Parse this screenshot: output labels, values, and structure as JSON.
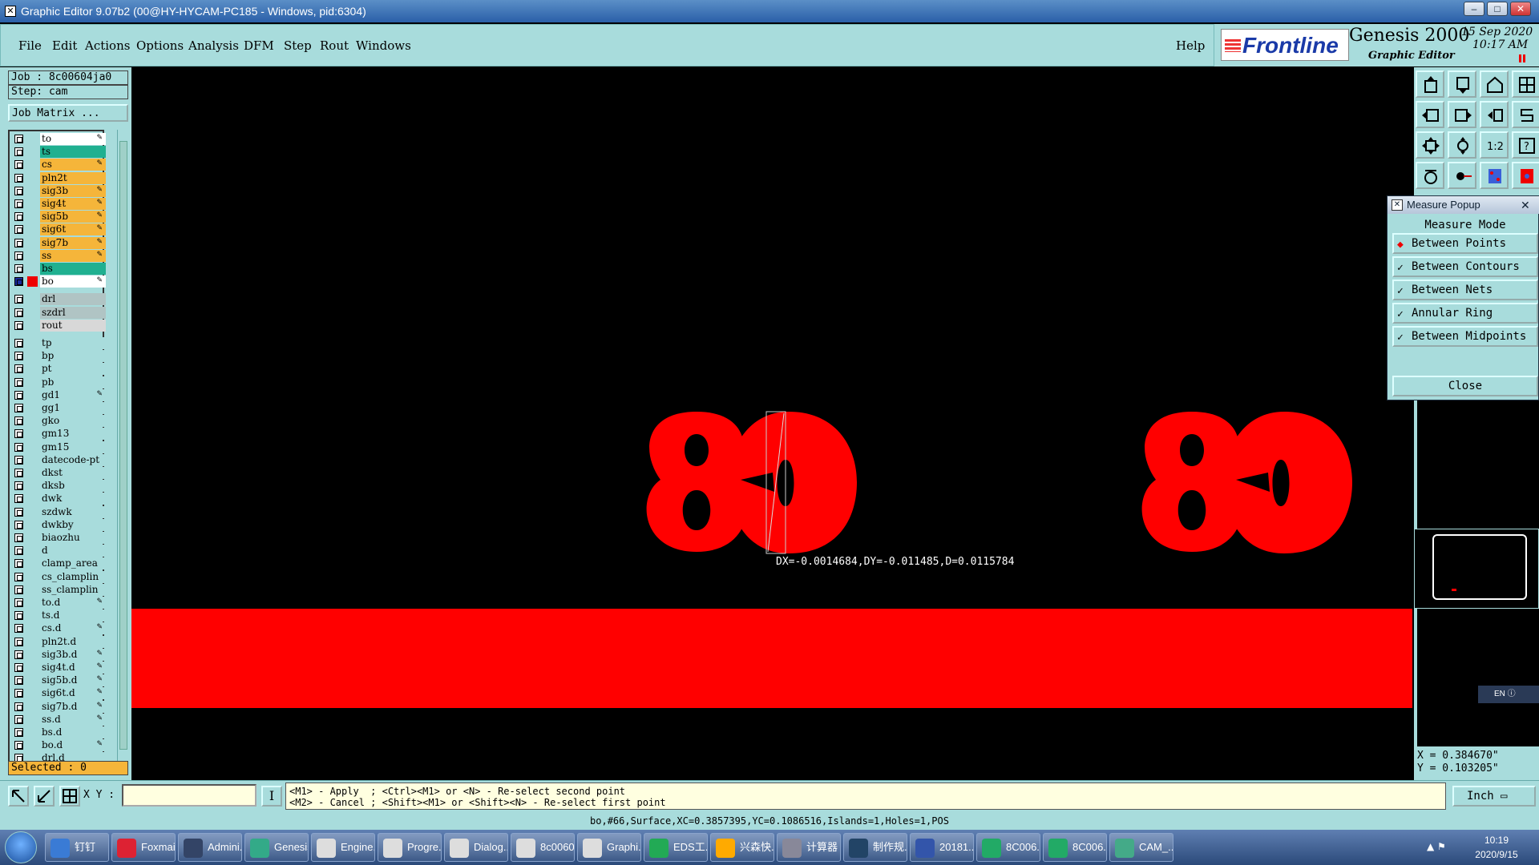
{
  "window": {
    "title": "Graphic Editor 9.07b2 (00@HY-HYCAM-PC185 - Windows, pid:6304)"
  },
  "menu": {
    "items": [
      "File",
      "Edit",
      "Actions",
      "Options",
      "Analysis",
      "DFM",
      "Step",
      "Rout",
      "Windows"
    ],
    "help": "Help"
  },
  "brand": {
    "logo": "Frontline",
    "product": "Genesis 2000",
    "subtitle": "Graphic Editor",
    "date": "15 Sep 2020",
    "time": "10:17 AM"
  },
  "job": {
    "job_label": "Job : 8c00604ja0",
    "step_label": "Step: cam",
    "matrix_button": "Job Matrix ...",
    "selected": "Selected : 0"
  },
  "layers": [
    {
      "name": "to",
      "color": "#ffffff",
      "edit": true
    },
    {
      "name": "ts",
      "color": "#20b090",
      "edit": false
    },
    {
      "name": "cs",
      "color": "#f5b53a",
      "edit": true
    },
    {
      "name": "pln2t",
      "color": "#f5b53a",
      "edit": false
    },
    {
      "name": "sig3b",
      "color": "#f5b53a",
      "edit": true
    },
    {
      "name": "sig4t",
      "color": "#f5b53a",
      "edit": true
    },
    {
      "name": "sig5b",
      "color": "#f5b53a",
      "edit": true
    },
    {
      "name": "sig6t",
      "color": "#f5b53a",
      "edit": true
    },
    {
      "name": "sig7b",
      "color": "#f5b53a",
      "edit": true
    },
    {
      "name": "ss",
      "color": "#f5b53a",
      "edit": true
    },
    {
      "name": "bs",
      "color": "#20b090",
      "edit": false
    },
    {
      "name": "bo",
      "color": "#ffffff",
      "edit": true,
      "active": true
    },
    {
      "name": "drl",
      "color": "#b0c4c4",
      "edit": false
    },
    {
      "name": "szdrl",
      "color": "#b0c4c4",
      "edit": false
    },
    {
      "name": "rout",
      "color": "#d8d8d8",
      "edit": false
    },
    {
      "name": "tp",
      "color": "#a8dcdc",
      "edit": false
    },
    {
      "name": "bp",
      "color": "#a8dcdc",
      "edit": false
    },
    {
      "name": "pt",
      "color": "#a8dcdc",
      "edit": false
    },
    {
      "name": "pb",
      "color": "#a8dcdc",
      "edit": false
    },
    {
      "name": "gd1",
      "color": "#a8dcdc",
      "edit": true
    },
    {
      "name": "gg1",
      "color": "#a8dcdc",
      "edit": false
    },
    {
      "name": "gko",
      "color": "#a8dcdc",
      "edit": false
    },
    {
      "name": "gm13",
      "color": "#a8dcdc",
      "edit": false
    },
    {
      "name": "gm15",
      "color": "#a8dcdc",
      "edit": false
    },
    {
      "name": "datecode-pt",
      "color": "#a8dcdc",
      "edit": false
    },
    {
      "name": "dkst",
      "color": "#a8dcdc",
      "edit": false
    },
    {
      "name": "dksb",
      "color": "#a8dcdc",
      "edit": false
    },
    {
      "name": "dwk",
      "color": "#a8dcdc",
      "edit": false
    },
    {
      "name": "szdwk",
      "color": "#a8dcdc",
      "edit": false
    },
    {
      "name": "dwkby",
      "color": "#a8dcdc",
      "edit": false
    },
    {
      "name": "biaozhu",
      "color": "#a8dcdc",
      "edit": false
    },
    {
      "name": "d",
      "color": "#a8dcdc",
      "edit": false
    },
    {
      "name": "clamp_area",
      "color": "#a8dcdc",
      "edit": false
    },
    {
      "name": "cs_clamplin",
      "color": "#a8dcdc",
      "edit": false
    },
    {
      "name": "ss_clamplin",
      "color": "#a8dcdc",
      "edit": false
    },
    {
      "name": "to.d",
      "color": "#a8dcdc",
      "edit": true
    },
    {
      "name": "ts.d",
      "color": "#a8dcdc",
      "edit": false
    },
    {
      "name": "cs.d",
      "color": "#a8dcdc",
      "edit": true
    },
    {
      "name": "pln2t.d",
      "color": "#a8dcdc",
      "edit": false
    },
    {
      "name": "sig3b.d",
      "color": "#a8dcdc",
      "edit": true
    },
    {
      "name": "sig4t.d",
      "color": "#a8dcdc",
      "edit": true
    },
    {
      "name": "sig5b.d",
      "color": "#a8dcdc",
      "edit": true
    },
    {
      "name": "sig6t.d",
      "color": "#a8dcdc",
      "edit": true
    },
    {
      "name": "sig7b.d",
      "color": "#a8dcdc",
      "edit": true
    },
    {
      "name": "ss.d",
      "color": "#a8dcdc",
      "edit": true
    },
    {
      "name": "bs.d",
      "color": "#a8dcdc",
      "edit": false
    },
    {
      "name": "bo.d",
      "color": "#a8dcdc",
      "edit": true
    },
    {
      "name": "drl.d",
      "color": "#a8dcdc",
      "edit": false
    }
  ],
  "canvas": {
    "measure_text": "DX=-0.0014684,DY=-0.011485,D=0.0115784",
    "feature_color": "#ff0000"
  },
  "measure_popup": {
    "title": "Measure Popup",
    "mode_label": "Measure Mode",
    "options": [
      "Between Points",
      "Between Contours",
      "Between Nets",
      "Annular Ring",
      "Between Midpoints"
    ],
    "selected": "Between Points",
    "close": "Close"
  },
  "coords": {
    "x": "X = 0.384670\"",
    "y": "Y = 0.103205\""
  },
  "command": {
    "xy_label": "X Y :",
    "xy_value": "",
    "prompt_line1": "<M1> - Apply  ; <Ctrl><M1> or <N> - Re-select second point",
    "prompt_line2": "<M2> - Cancel ; <Shift><M1> or <Shift><N> - Re-select first point",
    "units": "Inch"
  },
  "status": "bo,#66,Surface,XC=0.3857395,YC=0.1086516,Islands=1,Holes=1,POS",
  "lang": "EN",
  "taskbar": {
    "items": [
      "钉钉",
      "Foxmail",
      "Admini...",
      "Genesis",
      "Engine...",
      "Progre...",
      "Dialog...",
      "8c0060...",
      "Graphi...",
      "EDS工...",
      "兴森快...",
      "计算器",
      "制作规...",
      "20181...",
      "8C006...",
      "8C006...",
      "CAM_..."
    ],
    "clock_time": "10:19",
    "clock_date": "2020/9/15"
  }
}
